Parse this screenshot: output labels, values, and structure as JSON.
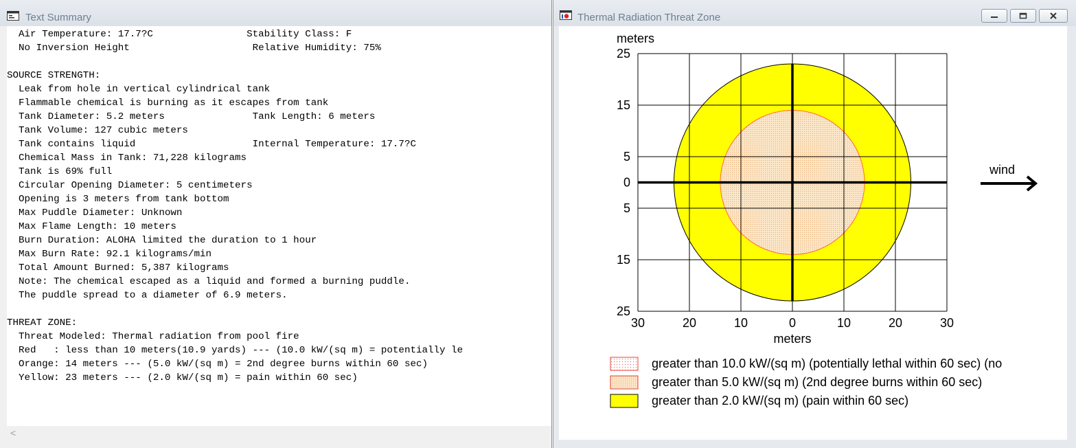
{
  "text_window": {
    "title": "Text Summary",
    "lines": [
      "  Air Temperature: 17.7?C                Stability Class: F",
      "  No Inversion Height                     Relative Humidity: 75%",
      "",
      "SOURCE STRENGTH:",
      "  Leak from hole in vertical cylindrical tank",
      "  Flammable chemical is burning as it escapes from tank",
      "  Tank Diameter: 5.2 meters               Tank Length: 6 meters",
      "  Tank Volume: 127 cubic meters",
      "  Tank contains liquid                    Internal Temperature: 17.7?C",
      "  Chemical Mass in Tank: 71,228 kilograms",
      "  Tank is 69% full",
      "  Circular Opening Diameter: 5 centimeters",
      "  Opening is 3 meters from tank bottom",
      "  Max Puddle Diameter: Unknown",
      "  Max Flame Length: 10 meters",
      "  Burn Duration: ALOHA limited the duration to 1 hour",
      "  Max Burn Rate: 92.1 kilograms/min",
      "  Total Amount Burned: 5,387 kilograms",
      "  Note: The chemical escaped as a liquid and formed a burning puddle.",
      "  The puddle spread to a diameter of 6.9 meters.",
      "",
      "THREAT ZONE:",
      "  Threat Modeled: Thermal radiation from pool fire",
      "  Red   : less than 10 meters(10.9 yards) --- (10.0 kW/(sq m) = potentially le",
      "  Orange: 14 meters --- (5.0 kW/(sq m) = 2nd degree burns within 60 sec)",
      "  Yellow: 23 meters --- (2.0 kW/(sq m) = pain within 60 sec)"
    ],
    "scroll_arrow": "<"
  },
  "plot_window": {
    "title": "Thermal Radiation Threat Zone",
    "wind_label": "wind"
  },
  "chart_data": {
    "type": "threat-zone",
    "y_unit_label": "meters",
    "x_unit_label": "meters",
    "x_ticks": [
      {
        "value": -30,
        "label": "30"
      },
      {
        "value": -20,
        "label": "20"
      },
      {
        "value": -10,
        "label": "10"
      },
      {
        "value": 0,
        "label": "0"
      },
      {
        "value": 10,
        "label": "10"
      },
      {
        "value": 20,
        "label": "20"
      },
      {
        "value": 30,
        "label": "30"
      }
    ],
    "y_ticks": [
      {
        "value": 25,
        "label": "25"
      },
      {
        "value": 15,
        "label": "15"
      },
      {
        "value": 5,
        "label": "5"
      },
      {
        "value": 0,
        "label": "0"
      },
      {
        "value": -5,
        "label": "5"
      },
      {
        "value": -15,
        "label": "15"
      },
      {
        "value": -25,
        "label": "25"
      }
    ],
    "xlim": [
      -30,
      30
    ],
    "ylim": [
      -25,
      25
    ],
    "grid": true,
    "zones": [
      {
        "color": "Yellow",
        "radius_m": 23,
        "fill": "#ffff00",
        "stroke": "#000000"
      },
      {
        "color": "Orange",
        "radius_m": 14,
        "fill": "#fbe3c2",
        "stroke": "#ff6a3a"
      }
    ],
    "legend": [
      {
        "text": "greater than 10.0 kW/(sq m) (potentially lethal within 60 sec) (no",
        "swatch": "red-dotted"
      },
      {
        "text": "greater than 5.0 kW/(sq m) (2nd degree burns within 60 sec)",
        "swatch": "orange-dotted"
      },
      {
        "text": "greater than 2.0 kW/(sq m) (pain within 60 sec)",
        "swatch": "yellow-solid"
      }
    ],
    "colors": {
      "red": "#e8403a",
      "orange": "#fbd29a",
      "yellow": "#ffff00"
    }
  }
}
